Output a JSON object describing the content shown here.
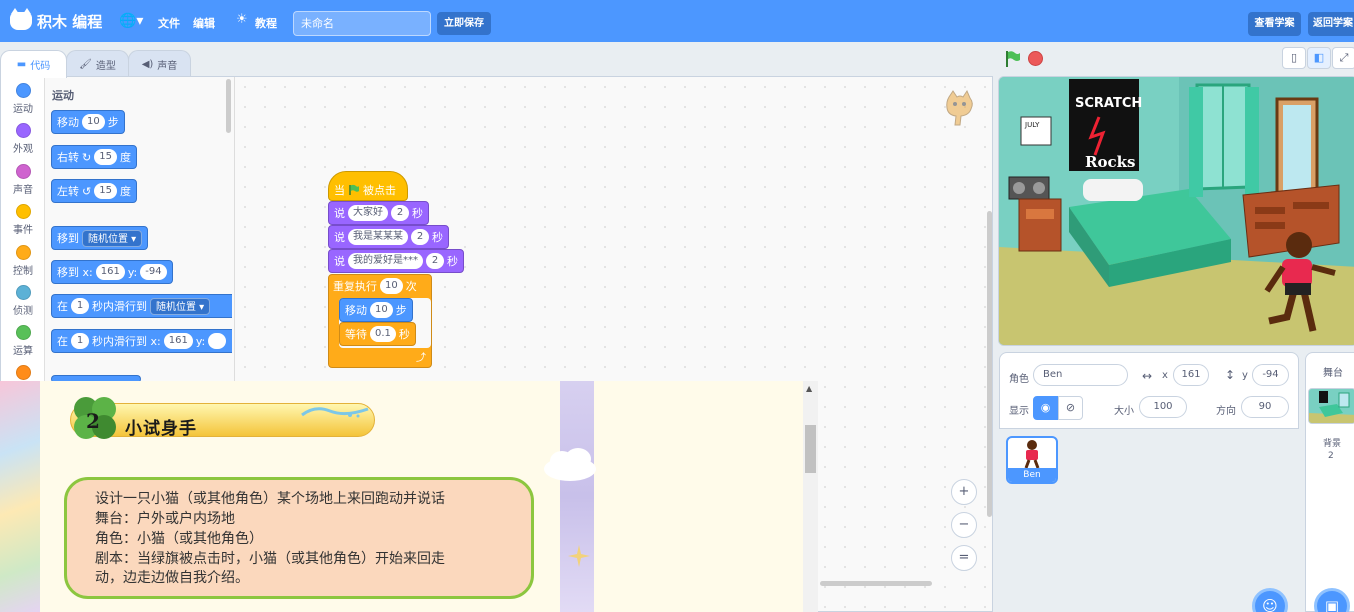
{
  "menubar": {
    "brand": "积木 编程",
    "file": "文件",
    "edit": "编辑",
    "tutorial": "教程",
    "project_title": "未命名",
    "save_now": "立即保存",
    "see_project": "查看学案",
    "back_project": "返回学案"
  },
  "tabs": {
    "code": "代码",
    "costumes": "造型",
    "sounds": "声音"
  },
  "categories": [
    {
      "label": "运动",
      "color": "#4c97ff"
    },
    {
      "label": "外观",
      "color": "#9966ff"
    },
    {
      "label": "声音",
      "color": "#cf63cf"
    },
    {
      "label": "事件",
      "color": "#ffbf00"
    },
    {
      "label": "控制",
      "color": "#ffab19"
    },
    {
      "label": "侦测",
      "color": "#5cb1d6"
    },
    {
      "label": "运算",
      "color": "#59c059"
    },
    {
      "label": "",
      "color": "#ff8c1a"
    }
  ],
  "palette": {
    "title": "运动",
    "move": {
      "text": "移动",
      "value": "10",
      "unit": "步"
    },
    "turn_right": {
      "text": "右转",
      "icon": "↻",
      "value": "15",
      "unit": "度"
    },
    "turn_left": {
      "text": "左转",
      "icon": "↺",
      "value": "15",
      "unit": "度"
    },
    "goto": {
      "text": "移到",
      "option": "随机位置"
    },
    "goto_xy": {
      "text": "移到 x:",
      "x": "161",
      "ylabel": "y:",
      "y": "-94"
    },
    "glide": {
      "pre": "在",
      "secs": "1",
      "text": "秒内滑行到",
      "option": "随机位置"
    },
    "glide_xy": {
      "pre": "在",
      "secs": "1",
      "text": "秒内滑行到 x:",
      "x": "161",
      "ylabel": "y:"
    }
  },
  "script": {
    "hat": {
      "pre": "当",
      "post": "被点击"
    },
    "say1": {
      "cmd": "说",
      "text": "大家好",
      "secs": "2",
      "unit": "秒"
    },
    "say2": {
      "cmd": "说",
      "text": "我是某某某",
      "secs": "2",
      "unit": "秒"
    },
    "say3": {
      "cmd": "说",
      "text": "我的爱好是***",
      "secs": "2",
      "unit": "秒"
    },
    "repeat": {
      "text": "重复执行",
      "times": "10",
      "unit": "次"
    },
    "move": {
      "text": "移动",
      "value": "10",
      "unit": "步"
    },
    "wait": {
      "text": "等待",
      "value": "0.1",
      "unit": "秒"
    },
    "loop_arrow": "⤴"
  },
  "zoom": {
    "in": "+",
    "out": "−",
    "reset": "="
  },
  "overlay": {
    "number": "2",
    "heading": "小试身手",
    "lines": [
      "设计一只小猫（或其他角色）某个场地上来回跑动并说话",
      "舞台：户外或户内场地",
      "角色：小猫（或其他角色）",
      "剧本：当绿旗被点击时，小猫（或其他角色）开始来回走",
      "动，边走边做自我介绍。"
    ]
  },
  "stage": {
    "poster_line1": "SCRATCH",
    "poster_line2": "Rocks",
    "calendar": "JULY"
  },
  "sprite": {
    "label_sprite": "角色",
    "name": "Ben",
    "label_x": "x",
    "x": "161",
    "label_y": "y",
    "y": "-94",
    "label_show": "显示",
    "label_size": "大小",
    "size": "100",
    "label_direction": "方向",
    "direction": "90"
  },
  "sprites": [
    {
      "name": "Ben"
    }
  ],
  "backdrop": {
    "title": "舞台",
    "label": "背景",
    "count": "2"
  }
}
